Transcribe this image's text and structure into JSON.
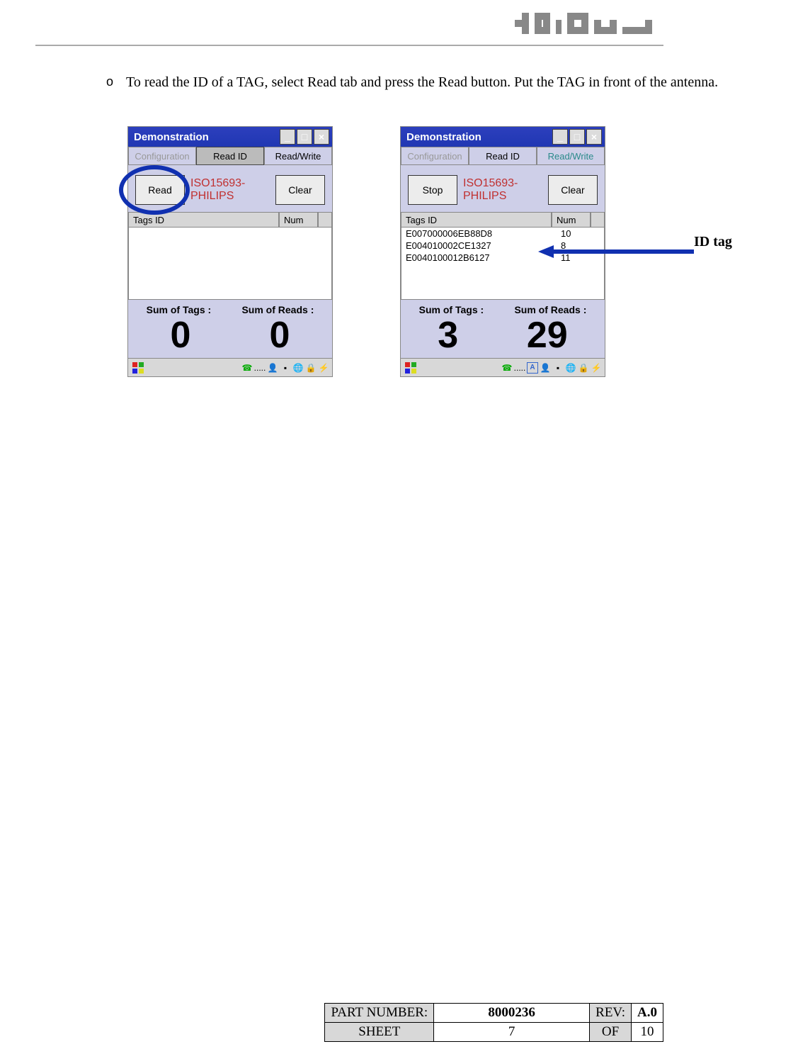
{
  "header": {
    "logo_text": "PSION"
  },
  "instruction": {
    "bullet": "o",
    "text": "To read the ID of a TAG, select Read tab and press the Read button. Put the TAG in front of the antenna."
  },
  "annotation": {
    "id_tag": "ID tag"
  },
  "windowA": {
    "title": "Demonstration",
    "tabs": {
      "config": "Configuration",
      "read_id": "Read ID",
      "read_write": "Read/Write"
    },
    "action_label": "Read",
    "clear_label": "Clear",
    "protocol_line1": "ISO15693-",
    "protocol_line2": "PHILIPS",
    "list_headers": {
      "id": "Tags ID",
      "num": "Num"
    },
    "sum_tags_label": "Sum of Tags :",
    "sum_reads_label": "Sum of Reads :",
    "sum_tags": "0",
    "sum_reads": "0",
    "rows": []
  },
  "windowB": {
    "title": "Demonstration",
    "tabs": {
      "config": "Configuration",
      "read_id": "Read ID",
      "read_write": "Read/Write"
    },
    "action_label": "Stop",
    "clear_label": "Clear",
    "protocol_line1": "ISO15693-",
    "protocol_line2": "PHILIPS",
    "list_headers": {
      "id": "Tags ID",
      "num": "Num"
    },
    "sum_tags_label": "Sum of Tags :",
    "sum_reads_label": "Sum of Reads :",
    "sum_tags": "3",
    "sum_reads": "29",
    "rows": [
      {
        "id": "E007000006EB88D8",
        "num": "10"
      },
      {
        "id": "E004010002CE1327",
        "num": "8"
      },
      {
        "id": "E0040100012B6127",
        "num": "11"
      }
    ]
  },
  "footer": {
    "part_number_label": "PART NUMBER:",
    "part_number": "8000236",
    "rev_label": "REV:",
    "rev": "A.0",
    "sheet_label": "SHEET",
    "page": "7",
    "of": "OF",
    "total": "10"
  }
}
